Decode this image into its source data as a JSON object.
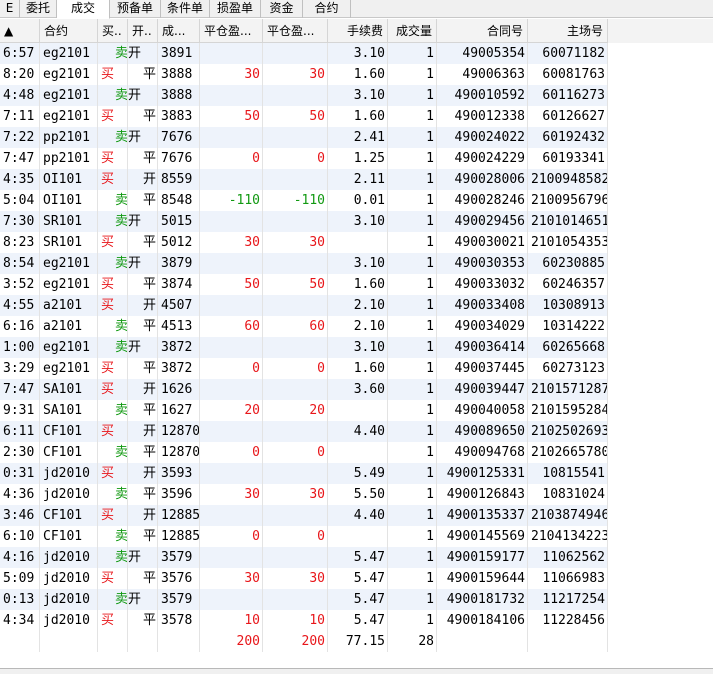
{
  "tabs": [
    {
      "label": "委托",
      "active": false
    },
    {
      "label": "成交",
      "active": true
    },
    {
      "label": "预备单",
      "active": false
    },
    {
      "label": "条件单",
      "active": false
    },
    {
      "label": "损盈单",
      "active": false
    },
    {
      "label": "资金",
      "active": false
    },
    {
      "label": "合约",
      "active": false
    }
  ],
  "tab_left_fragment": "E",
  "columns": {
    "time": "▲",
    "contract": "合约",
    "buy_sell": "买..",
    "open_close": "开..",
    "price": "成...",
    "close_pnl_a": "平仓盈...",
    "close_pnl_b": "平仓盈...",
    "fee": "手续费",
    "volume": "成交量",
    "contract_no": "合同号",
    "exchange_no": "主场号"
  },
  "rows": [
    {
      "time": "6:57",
      "contract": "eg2101",
      "buy": "",
      "sell": "卖",
      "oc": "开",
      "price": "3891",
      "pnl_a": "",
      "pnl_b": "",
      "fee": "3.10",
      "vol": "1",
      "contract_no": "49005354",
      "exchange_no": "60071182"
    },
    {
      "time": "8:20",
      "contract": "eg2101",
      "buy": "买",
      "sell": "",
      "oc": "平",
      "price": "3888",
      "pnl_a": "30",
      "pnl_b": "30",
      "fee": "1.60",
      "vol": "1",
      "contract_no": "49006363",
      "exchange_no": "60081763"
    },
    {
      "time": "4:48",
      "contract": "eg2101",
      "buy": "",
      "sell": "卖",
      "oc": "开",
      "price": "3888",
      "pnl_a": "",
      "pnl_b": "",
      "fee": "3.10",
      "vol": "1",
      "contract_no": "490010592",
      "exchange_no": "60116273"
    },
    {
      "time": "7:11",
      "contract": "eg2101",
      "buy": "买",
      "sell": "",
      "oc": "平",
      "price": "3883",
      "pnl_a": "50",
      "pnl_b": "50",
      "fee": "1.60",
      "vol": "1",
      "contract_no": "490012338",
      "exchange_no": "60126627"
    },
    {
      "time": "7:22",
      "contract": "pp2101",
      "buy": "",
      "sell": "卖",
      "oc": "开",
      "price": "7676",
      "pnl_a": "",
      "pnl_b": "",
      "fee": "2.41",
      "vol": "1",
      "contract_no": "490024022",
      "exchange_no": "60192432"
    },
    {
      "time": "7:47",
      "contract": "pp2101",
      "buy": "买",
      "sell": "",
      "oc": "平",
      "price": "7676",
      "pnl_a": "0",
      "pnl_b": "0",
      "fee": "1.25",
      "vol": "1",
      "contract_no": "490024229",
      "exchange_no": "60193341"
    },
    {
      "time": "4:35",
      "contract": "OI101",
      "buy": "买",
      "sell": "",
      "oc": "开",
      "price": "8559",
      "pnl_a": "",
      "pnl_b": "",
      "fee": "2.11",
      "vol": "1",
      "contract_no": "490028006",
      "exchange_no": "2100948582"
    },
    {
      "time": "5:04",
      "contract": "OI101",
      "buy": "",
      "sell": "卖",
      "oc": "平",
      "price": "8548",
      "pnl_a": "-110",
      "pnl_b": "-110",
      "fee": "0.01",
      "vol": "1",
      "contract_no": "490028246",
      "exchange_no": "2100956796"
    },
    {
      "time": "7:30",
      "contract": "SR101",
      "buy": "",
      "sell": "卖",
      "oc": "开",
      "price": "5015",
      "pnl_a": "",
      "pnl_b": "",
      "fee": "3.10",
      "vol": "1",
      "contract_no": "490029456",
      "exchange_no": "2101014651"
    },
    {
      "time": "8:23",
      "contract": "SR101",
      "buy": "买",
      "sell": "",
      "oc": "平",
      "price": "5012",
      "pnl_a": "30",
      "pnl_b": "30",
      "fee": "",
      "vol": "1",
      "contract_no": "490030021",
      "exchange_no": "2101054353"
    },
    {
      "time": "8:54",
      "contract": "eg2101",
      "buy": "",
      "sell": "卖",
      "oc": "开",
      "price": "3879",
      "pnl_a": "",
      "pnl_b": "",
      "fee": "3.10",
      "vol": "1",
      "contract_no": "490030353",
      "exchange_no": "60230885"
    },
    {
      "time": "3:52",
      "contract": "eg2101",
      "buy": "买",
      "sell": "",
      "oc": "平",
      "price": "3874",
      "pnl_a": "50",
      "pnl_b": "50",
      "fee": "1.60",
      "vol": "1",
      "contract_no": "490033032",
      "exchange_no": "60246357"
    },
    {
      "time": "4:55",
      "contract": "a2101",
      "buy": "买",
      "sell": "",
      "oc": "开",
      "price": "4507",
      "pnl_a": "",
      "pnl_b": "",
      "fee": "2.10",
      "vol": "1",
      "contract_no": "490033408",
      "exchange_no": "10308913"
    },
    {
      "time": "6:16",
      "contract": "a2101",
      "buy": "",
      "sell": "卖",
      "oc": "平",
      "price": "4513",
      "pnl_a": "60",
      "pnl_b": "60",
      "fee": "2.10",
      "vol": "1",
      "contract_no": "490034029",
      "exchange_no": "10314222"
    },
    {
      "time": "1:00",
      "contract": "eg2101",
      "buy": "",
      "sell": "卖",
      "oc": "开",
      "price": "3872",
      "pnl_a": "",
      "pnl_b": "",
      "fee": "3.10",
      "vol": "1",
      "contract_no": "490036414",
      "exchange_no": "60265668"
    },
    {
      "time": "3:29",
      "contract": "eg2101",
      "buy": "买",
      "sell": "",
      "oc": "平",
      "price": "3872",
      "pnl_a": "0",
      "pnl_b": "0",
      "fee": "1.60",
      "vol": "1",
      "contract_no": "490037445",
      "exchange_no": "60273123"
    },
    {
      "time": "7:47",
      "contract": "SA101",
      "buy": "买",
      "sell": "",
      "oc": "开",
      "price": "1626",
      "pnl_a": "",
      "pnl_b": "",
      "fee": "3.60",
      "vol": "1",
      "contract_no": "490039447",
      "exchange_no": "2101571287"
    },
    {
      "time": "9:31",
      "contract": "SA101",
      "buy": "",
      "sell": "卖",
      "oc": "平",
      "price": "1627",
      "pnl_a": "20",
      "pnl_b": "20",
      "fee": "",
      "vol": "1",
      "contract_no": "490040058",
      "exchange_no": "2101595284"
    },
    {
      "time": "6:11",
      "contract": "CF101",
      "buy": "买",
      "sell": "",
      "oc": "开",
      "price": "12870",
      "pnl_a": "",
      "pnl_b": "",
      "fee": "4.40",
      "vol": "1",
      "contract_no": "490089650",
      "exchange_no": "2102502693"
    },
    {
      "time": "2:30",
      "contract": "CF101",
      "buy": "",
      "sell": "卖",
      "oc": "平",
      "price": "12870",
      "pnl_a": "0",
      "pnl_b": "0",
      "fee": "",
      "vol": "1",
      "contract_no": "490094768",
      "exchange_no": "2102665780"
    },
    {
      "time": "0:31",
      "contract": "jd2010",
      "buy": "买",
      "sell": "",
      "oc": "开",
      "price": "3593",
      "pnl_a": "",
      "pnl_b": "",
      "fee": "5.49",
      "vol": "1",
      "contract_no": "4900125331",
      "exchange_no": "10815541"
    },
    {
      "time": "4:36",
      "contract": "jd2010",
      "buy": "",
      "sell": "卖",
      "oc": "平",
      "price": "3596",
      "pnl_a": "30",
      "pnl_b": "30",
      "fee": "5.50",
      "vol": "1",
      "contract_no": "4900126843",
      "exchange_no": "10831024"
    },
    {
      "time": "3:46",
      "contract": "CF101",
      "buy": "买",
      "sell": "",
      "oc": "开",
      "price": "12885",
      "pnl_a": "",
      "pnl_b": "",
      "fee": "4.40",
      "vol": "1",
      "contract_no": "4900135337",
      "exchange_no": "2103874946"
    },
    {
      "time": "6:10",
      "contract": "CF101",
      "buy": "",
      "sell": "卖",
      "oc": "平",
      "price": "12885",
      "pnl_a": "0",
      "pnl_b": "0",
      "fee": "",
      "vol": "1",
      "contract_no": "4900145569",
      "exchange_no": "2104134223"
    },
    {
      "time": "4:16",
      "contract": "jd2010",
      "buy": "",
      "sell": "卖",
      "oc": "开",
      "price": "3579",
      "pnl_a": "",
      "pnl_b": "",
      "fee": "5.47",
      "vol": "1",
      "contract_no": "4900159177",
      "exchange_no": "11062562"
    },
    {
      "time": "5:09",
      "contract": "jd2010",
      "buy": "买",
      "sell": "",
      "oc": "平",
      "price": "3576",
      "pnl_a": "30",
      "pnl_b": "30",
      "fee": "5.47",
      "vol": "1",
      "contract_no": "4900159644",
      "exchange_no": "11066983"
    },
    {
      "time": "0:13",
      "contract": "jd2010",
      "buy": "",
      "sell": "卖",
      "oc": "开",
      "price": "3579",
      "pnl_a": "",
      "pnl_b": "",
      "fee": "5.47",
      "vol": "1",
      "contract_no": "4900181732",
      "exchange_no": "11217254"
    },
    {
      "time": "4:34",
      "contract": "jd2010",
      "buy": "买",
      "sell": "",
      "oc": "平",
      "price": "3578",
      "pnl_a": "10",
      "pnl_b": "10",
      "fee": "5.47",
      "vol": "1",
      "contract_no": "4900184106",
      "exchange_no": "11228456"
    }
  ],
  "totals": {
    "pnl_a": "200",
    "pnl_b": "200",
    "fee": "77.15",
    "vol": "28"
  },
  "colors": {
    "buy": "#e8161a",
    "sell": "#119911",
    "pnl": "#e8161a",
    "pnl_negative": "#119911",
    "alt_row": "#eef3fb"
  }
}
